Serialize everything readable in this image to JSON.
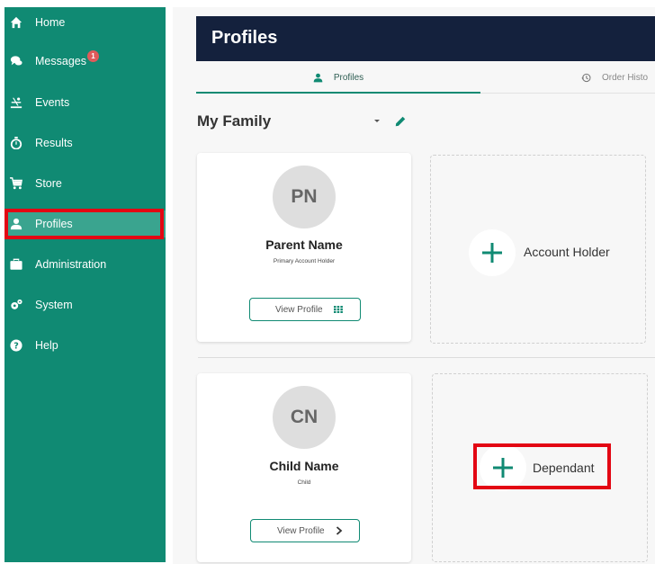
{
  "sidebar": {
    "items": [
      {
        "label": "Home",
        "icon": "home-icon"
      },
      {
        "label": "Messages",
        "icon": "chat-icon",
        "badge": "1"
      },
      {
        "label": "Events",
        "icon": "events-icon"
      },
      {
        "label": "Results",
        "icon": "stopwatch-icon"
      },
      {
        "label": "Store",
        "icon": "cart-icon"
      },
      {
        "label": "Profiles",
        "icon": "user-icon",
        "active": true
      },
      {
        "label": "Administration",
        "icon": "briefcase-icon"
      },
      {
        "label": "System",
        "icon": "gears-icon"
      },
      {
        "label": "Help",
        "icon": "question-icon"
      }
    ]
  },
  "header": {
    "title": "Profiles"
  },
  "tabs": [
    {
      "label": "Profiles",
      "icon": "user-icon",
      "active": true
    },
    {
      "label": "Order Histo",
      "icon": "history-icon"
    }
  ],
  "family": {
    "title": "My Family"
  },
  "cards": [
    {
      "initials": "PN",
      "name": "Parent Name",
      "role": "Primary Account Holder",
      "button": "View Profile",
      "button_icon": "grid-icon"
    },
    {
      "initials": "CN",
      "name": "Child Name",
      "role": "Child",
      "button": "View Profile",
      "button_icon": "chevron-right-icon"
    }
  ],
  "add_cards": [
    {
      "label": "Account Holder",
      "icon": "plus-icon"
    },
    {
      "label": "Dependant",
      "icon": "plus-icon"
    }
  ],
  "colors": {
    "sidebar": "#108a73",
    "sidebar_active": "#3aa48f",
    "header": "#14213d",
    "accent": "#108a73",
    "highlight": "#e30613",
    "badge": "#e05a5a"
  }
}
